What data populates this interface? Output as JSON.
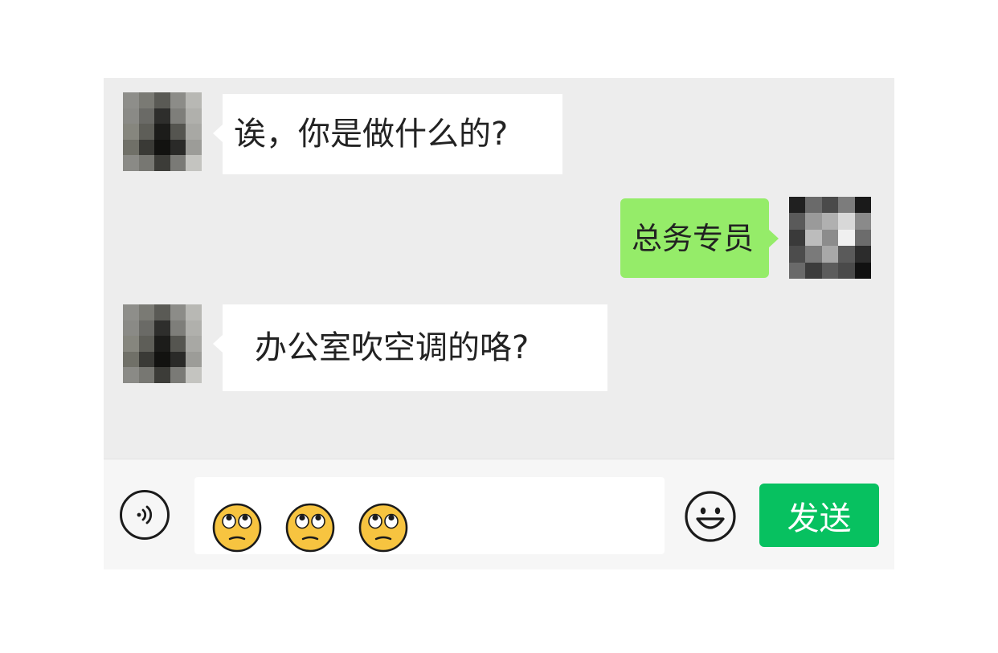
{
  "messages": [
    {
      "direction": "incoming",
      "text": "诶，你是做什么的?"
    },
    {
      "direction": "outgoing",
      "text": "总务专员"
    },
    {
      "direction": "incoming",
      "text": "办公室吹空调的咯?"
    }
  ],
  "input": {
    "emoji_count": 3,
    "emoji_icon": "eye-roll-emoji-icon"
  },
  "toolbar": {
    "voice_icon": "voice-icon",
    "emoji_icon": "smiley-icon",
    "send_label": "发送"
  },
  "colors": {
    "background": "#ededed",
    "incoming_bubble": "#ffffff",
    "outgoing_bubble": "#95ec69",
    "send_button": "#07c160"
  }
}
